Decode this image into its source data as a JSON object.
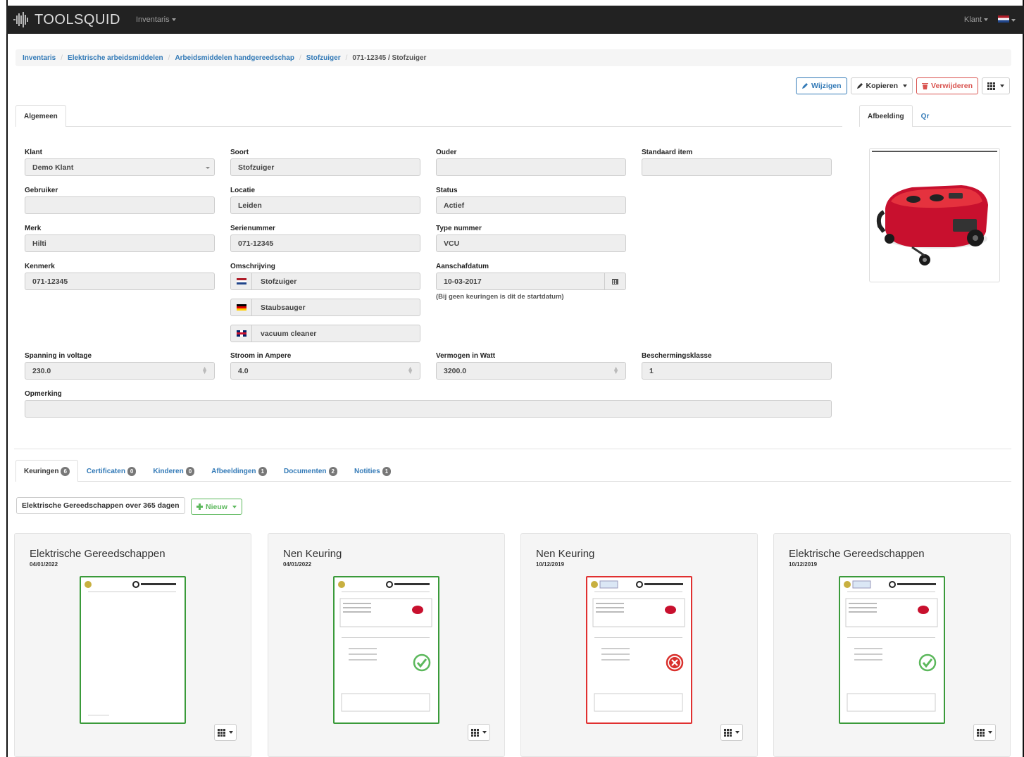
{
  "navbar": {
    "brand": "TOOLSQUID",
    "menu_label": "Inventaris",
    "client_label": "Klant"
  },
  "breadcrumb": [
    "Inventaris",
    "Elektrische arbeidsmiddelen",
    "Arbeidsmiddelen handgereedschap",
    "Stofzuiger",
    "071-12345 / Stofzuiger"
  ],
  "toolbar": {
    "edit": "Wijzigen",
    "copy": "Kopieren",
    "delete": "Verwijderen"
  },
  "tabs_main": [
    "Algemeen"
  ],
  "tabs_side": [
    "Afbeelding",
    "Qr"
  ],
  "form": {
    "klant": {
      "label": "Klant",
      "value": "Demo Klant"
    },
    "soort": {
      "label": "Soort",
      "value": "Stofzuiger"
    },
    "ouder": {
      "label": "Ouder",
      "value": ""
    },
    "standaard": {
      "label": "Standaard item",
      "value": ""
    },
    "gebruiker": {
      "label": "Gebruiker",
      "value": ""
    },
    "locatie": {
      "label": "Locatie",
      "value": "Leiden"
    },
    "status": {
      "label": "Status",
      "value": "Actief"
    },
    "merk": {
      "label": "Merk",
      "value": "Hilti"
    },
    "serienummer": {
      "label": "Serienummer",
      "value": "071-12345"
    },
    "typenummer": {
      "label": "Type nummer",
      "value": "VCU"
    },
    "kenmerk": {
      "label": "Kenmerk",
      "value": "071-12345"
    },
    "omschrijving": {
      "label": "Omschrijving",
      "nl": "Stofzuiger",
      "de": "Staubsauger",
      "en": "vacuum cleaner"
    },
    "aanschafdatum": {
      "label": "Aanschafdatum",
      "value": "10-03-2017",
      "hint": "(Bij geen keuringen is dit de startdatum)"
    },
    "spanning": {
      "label": "Spanning in voltage",
      "value": "230.0"
    },
    "stroom": {
      "label": "Stroom in Ampere",
      "value": "4.0"
    },
    "vermogen": {
      "label": "Vermogen in Watt",
      "value": "3200.0"
    },
    "bescherming": {
      "label": "Beschermingsklasse",
      "value": "1"
    },
    "opmerking": {
      "label": "Opmerking",
      "value": ""
    }
  },
  "bottom_tabs": [
    {
      "label": "Keuringen",
      "count": "6"
    },
    {
      "label": "Certificaten",
      "count": "0"
    },
    {
      "label": "Kinderen",
      "count": "0"
    },
    {
      "label": "Afbeeldingen",
      "count": "1"
    },
    {
      "label": "Documenten",
      "count": "2"
    },
    {
      "label": "Notities",
      "count": "1"
    }
  ],
  "filter_button": "Elektrische Gereedschappen over 365 dagen",
  "new_button": "Nieuw",
  "cards": [
    {
      "title": "Elektrische Gereedschappen",
      "date": "04/01/2022",
      "status": "none"
    },
    {
      "title": "Nen Keuring",
      "date": "04/01/2022",
      "status": "pass"
    },
    {
      "title": "Nen Keuring",
      "date": "10/12/2019",
      "status": "fail"
    },
    {
      "title": "Elektrische Gereedschappen",
      "date": "10/12/2019",
      "status": "pass"
    }
  ],
  "colors": {
    "primary": "#337ab7",
    "danger": "#d9534f",
    "success": "#5cb85c",
    "navbar": "#222222"
  },
  "icons": [
    "pencil-icon",
    "copy-icon",
    "trash-icon",
    "grid-icon",
    "calendar-icon",
    "plus-icon",
    "check-circle-icon",
    "x-circle-icon"
  ]
}
